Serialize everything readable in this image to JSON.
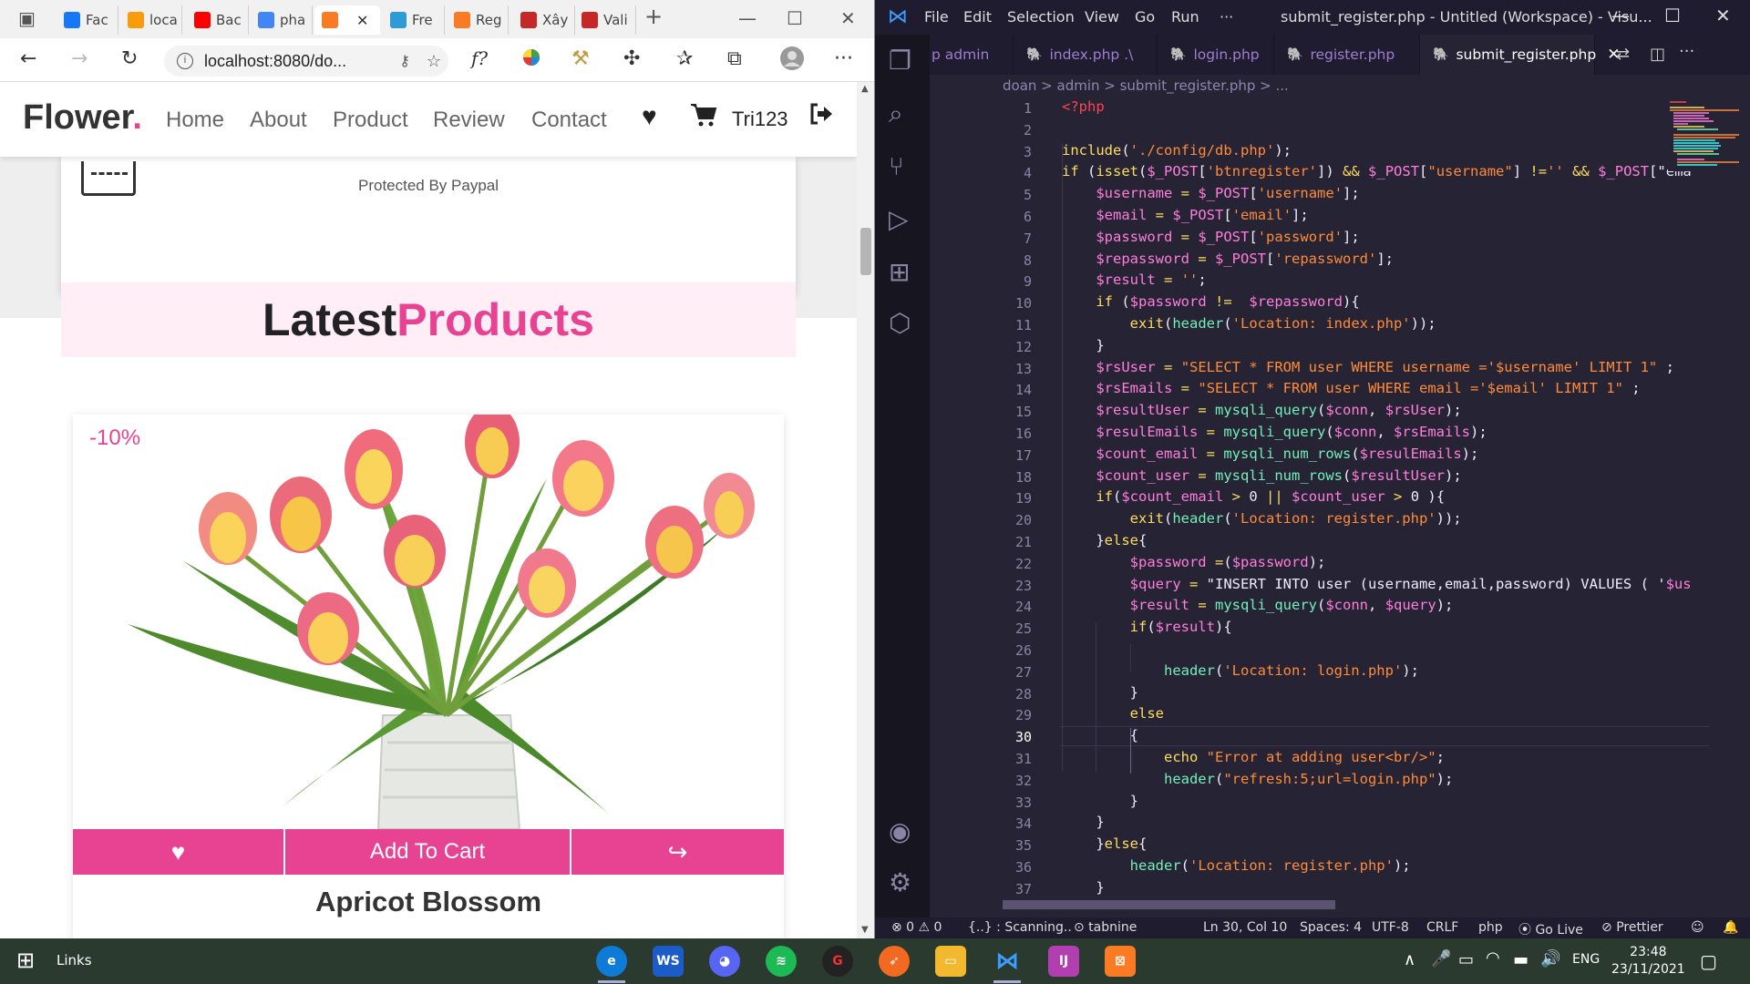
{
  "browser": {
    "tabs": [
      {
        "label": "Fac",
        "icon": "facebook-icon",
        "color": "#1877f2"
      },
      {
        "label": "loca",
        "icon": "phpmyadmin-icon",
        "color": "#f89c0e"
      },
      {
        "label": "Bac",
        "icon": "youtube-icon",
        "color": "#ff0000"
      },
      {
        "label": "pha",
        "icon": "google-icon",
        "color": "#4285f4"
      },
      {
        "label": "",
        "icon": "xampp-icon",
        "color": "#fb7a24"
      },
      {
        "label": "Fre",
        "icon": "bd-icon",
        "color": "#2e9bd6"
      },
      {
        "label": "Reg",
        "icon": "xampp-icon",
        "color": "#fb7a24"
      },
      {
        "label": "Xây",
        "icon": "redirect-icon",
        "color": "#c62828"
      },
      {
        "label": "Vali",
        "icon": "redirect-icon",
        "color": "#c62828"
      }
    ],
    "url": "localhost:8080/do...",
    "font_btn": "f?"
  },
  "site": {
    "logo": "Flower",
    "logo_dot": ".",
    "nav": [
      "Home",
      "About",
      "Product",
      "Review",
      "Contact"
    ],
    "username": "Tri123",
    "paypal_text": "Protected By Paypal",
    "section_title_1": "Latest",
    "section_title_2": "Products",
    "discount": "-10%",
    "add_to_cart": "Add To Cart",
    "product_name": "Apricot Blossom",
    "accent": "#e84393"
  },
  "vscode": {
    "menu": [
      "File",
      "Edit",
      "Selection",
      "View",
      "Go",
      "Run",
      "···"
    ],
    "title": "submit_register.php - Untitled (Workspace) - Visu...",
    "tabs": [
      "p admin",
      "index.php .\\",
      "login.php",
      "register.php",
      "submit_register.php"
    ],
    "breadcrumb": "doan > admin > submit_register.php > ...",
    "code_lines": [
      "<?php",
      "",
      "include('./config/db.php');",
      "if (isset($_POST['btnregister']) && $_POST[\"username\"] !='' && $_POST[\"ema",
      "    $username = $_POST['username'];",
      "    $email = $_POST['email'];",
      "    $password = $_POST['password'];",
      "    $repassword = $_POST['repassword'];",
      "    $result = '';",
      "    if ($password !=  $repassword){",
      "        exit(header('Location: index.php'));",
      "    }",
      "    $rsUser = \"SELECT * FROM user WHERE username ='$username' LIMIT 1\" ;",
      "    $rsEmails = \"SELECT * FROM user WHERE email ='$email' LIMIT 1\" ;",
      "    $resultUser = mysqli_query($conn, $rsUser);",
      "    $resulEmails = mysqli_query($conn, $rsEmails);",
      "    $count_email = mysqli_num_rows($resulEmails);",
      "    $count_user = mysqli_num_rows($resultUser);",
      "    if($count_email > 0 || $count_user > 0 ){",
      "        exit(header('Location: register.php'));",
      "    }else{",
      "        $password =($password);",
      "        $query = \"INSERT INTO user (username,email,password) VALUES ( '$us",
      "        $result = mysqli_query($conn, $query);",
      "        if($result){",
      "",
      "            header('Location: login.php');",
      "        }",
      "        else",
      "        {",
      "            echo \"Error at adding user<br/>\";",
      "            header(\"refresh:5;url=login.php\");",
      "        }",
      "    }",
      "    }else{",
      "        header('Location: register.php');",
      "    }",
      "?>"
    ],
    "current_line": 30,
    "status": {
      "problems": "⊗ 0 ⚠ 0",
      "scanning": "{..} : Scanning..",
      "tabnine": "⊙ tabnine",
      "position": "Ln 30, Col 10",
      "spaces": "Spaces: 4",
      "encoding": "UTF-8",
      "eol": "CRLF",
      "language": "php",
      "golive": "Go Live",
      "prettier": "Prettier"
    }
  },
  "taskbar": {
    "links": "Links",
    "lang": "ENG",
    "time": "23:48",
    "date": "23/11/2021"
  }
}
